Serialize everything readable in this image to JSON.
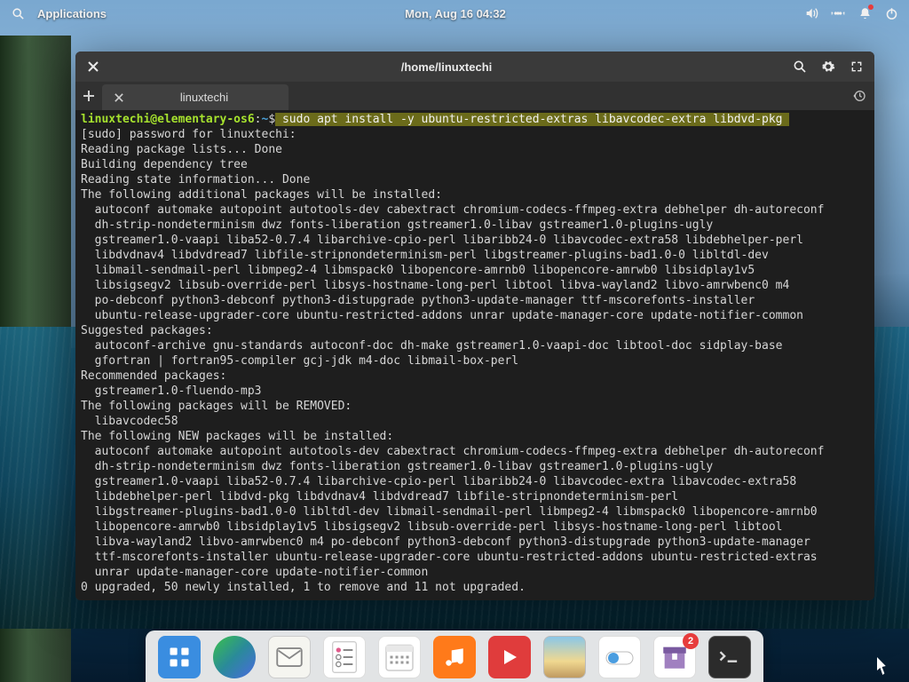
{
  "topbar": {
    "applications_label": "Applications",
    "datetime": "Mon, Aug 16   04:32"
  },
  "window": {
    "title": "/home/linuxtechi",
    "tab_label": "linuxtechi"
  },
  "prompt": {
    "user_host": "linuxtechi@elementary-os6",
    "separator": ":",
    "path": "~",
    "dollar": "$",
    "command": " sudo apt install -y ubuntu-restricted-extras libavcodec-extra libdvd-pkg "
  },
  "output_lines": [
    "[sudo] password for linuxtechi:",
    "Reading package lists... Done",
    "Building dependency tree",
    "Reading state information... Done",
    "The following additional packages will be installed:",
    "  autoconf automake autopoint autotools-dev cabextract chromium-codecs-ffmpeg-extra debhelper dh-autoreconf",
    "  dh-strip-nondeterminism dwz fonts-liberation gstreamer1.0-libav gstreamer1.0-plugins-ugly",
    "  gstreamer1.0-vaapi liba52-0.7.4 libarchive-cpio-perl libaribb24-0 libavcodec-extra58 libdebhelper-perl",
    "  libdvdnav4 libdvdread7 libfile-stripnondeterminism-perl libgstreamer-plugins-bad1.0-0 libltdl-dev",
    "  libmail-sendmail-perl libmpeg2-4 libmspack0 libopencore-amrnb0 libopencore-amrwb0 libsidplay1v5",
    "  libsigsegv2 libsub-override-perl libsys-hostname-long-perl libtool libva-wayland2 libvo-amrwbenc0 m4",
    "  po-debconf python3-debconf python3-distupgrade python3-update-manager ttf-mscorefonts-installer",
    "  ubuntu-release-upgrader-core ubuntu-restricted-addons unrar update-manager-core update-notifier-common",
    "Suggested packages:",
    "  autoconf-archive gnu-standards autoconf-doc dh-make gstreamer1.0-vaapi-doc libtool-doc sidplay-base",
    "  gfortran | fortran95-compiler gcj-jdk m4-doc libmail-box-perl",
    "Recommended packages:",
    "  gstreamer1.0-fluendo-mp3",
    "The following packages will be REMOVED:",
    "  libavcodec58",
    "The following NEW packages will be installed:",
    "  autoconf automake autopoint autotools-dev cabextract chromium-codecs-ffmpeg-extra debhelper dh-autoreconf",
    "  dh-strip-nondeterminism dwz fonts-liberation gstreamer1.0-libav gstreamer1.0-plugins-ugly",
    "  gstreamer1.0-vaapi liba52-0.7.4 libarchive-cpio-perl libaribb24-0 libavcodec-extra libavcodec-extra58",
    "  libdebhelper-perl libdvd-pkg libdvdnav4 libdvdread7 libfile-stripnondeterminism-perl",
    "  libgstreamer-plugins-bad1.0-0 libltdl-dev libmail-sendmail-perl libmpeg2-4 libmspack0 libopencore-amrnb0",
    "  libopencore-amrwb0 libsidplay1v5 libsigsegv2 libsub-override-perl libsys-hostname-long-perl libtool",
    "  libva-wayland2 libvo-amrwbenc0 m4 po-debconf python3-debconf python3-distupgrade python3-update-manager",
    "  ttf-mscorefonts-installer ubuntu-release-upgrader-core ubuntu-restricted-addons ubuntu-restricted-extras",
    "  unrar update-manager-core update-notifier-common",
    "0 upgraded, 50 newly installed, 1 to remove and 11 not upgraded."
  ],
  "dock": {
    "badge_appcenter": "2"
  }
}
